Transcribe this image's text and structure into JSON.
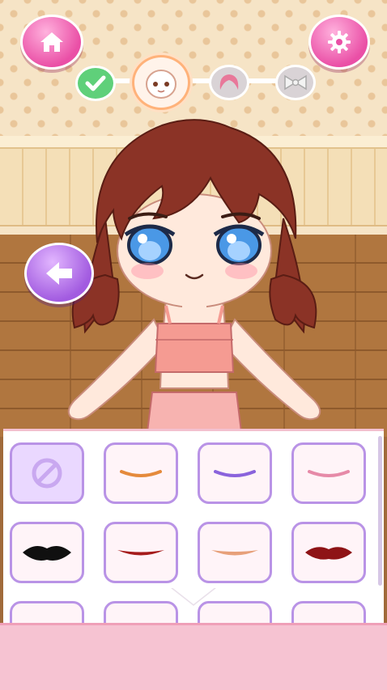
{
  "header": {
    "home_icon": "home-icon",
    "settings_icon": "gear-icon"
  },
  "steps": [
    {
      "id": "done",
      "icon": "checkmark-icon",
      "state": "completed"
    },
    {
      "id": "face",
      "icon": "face-icon",
      "state": "active"
    },
    {
      "id": "hair",
      "icon": "hair-icon",
      "state": "locked"
    },
    {
      "id": "accessory",
      "icon": "bow-icon",
      "state": "locked"
    }
  ],
  "navigation": {
    "back_icon": "arrow-left-icon"
  },
  "lip_options": [
    {
      "id": "none",
      "icon": "no-symbol-icon",
      "selected": true
    },
    {
      "id": "orange-smile",
      "color": "#e58a3c"
    },
    {
      "id": "purple-smile",
      "color": "#8a63dc"
    },
    {
      "id": "pink-smile",
      "color": "#e68aa8"
    },
    {
      "id": "black-lips",
      "color": "#101010"
    },
    {
      "id": "red-smile",
      "color": "#a51c1c"
    },
    {
      "id": "peach-smile",
      "color": "#e7a07a"
    },
    {
      "id": "darkred-lips",
      "color": "#8e1316"
    },
    {
      "id": "red-lips-partial",
      "color": "#c81f1f"
    },
    {
      "id": "pink-smile-partial",
      "color": "#e07a9a"
    },
    {
      "id": "purple-lips-partial",
      "color": "#9a59d6"
    },
    {
      "id": "brown-lips-partial",
      "color": "#b9582e"
    }
  ],
  "colors": {
    "pink_button": "#ea4fa6",
    "purple_button": "#a25be0",
    "hair": "#8b3326",
    "skin": "#ffe9dc",
    "eyes": "#4a98e6",
    "top": "#f59b92",
    "skirt": "#f7b3b0",
    "panel_border": "#b993e6",
    "bottom_bar": "#f6c3d2"
  }
}
